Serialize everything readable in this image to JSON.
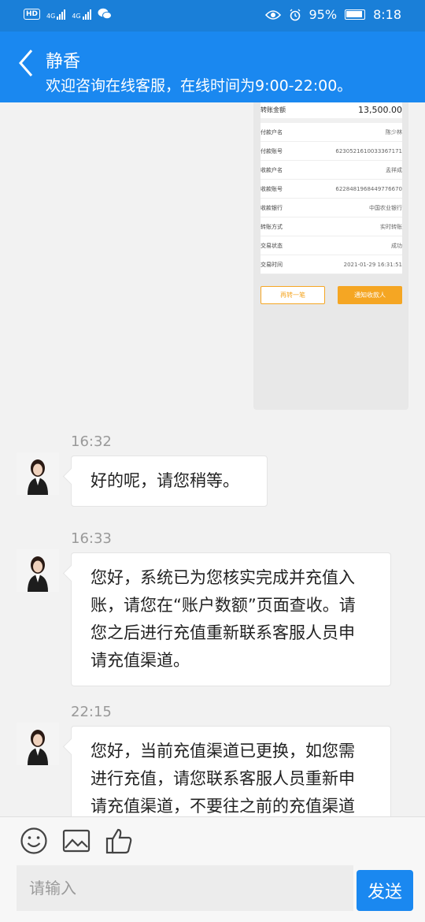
{
  "status_bar": {
    "network_left": "HD",
    "sim1": "4G",
    "sim2": "4G",
    "battery_percent": "95%",
    "time": "8:18"
  },
  "header": {
    "title": "静香",
    "subtitle": "欢迎咨询在线客服，在线时间为9:00-22:00。"
  },
  "receipt": {
    "amount_label": "转账金额",
    "amount_value": "13,500.00",
    "rows": [
      {
        "label": "付款户名",
        "value": "陈少林"
      },
      {
        "label": "付款账号",
        "value": "6230521610033367171"
      },
      {
        "label": "收款户名",
        "value": "孟祥成"
      },
      {
        "label": "收款账号",
        "value": "6228481968449776670"
      },
      {
        "label": "收款银行",
        "value": "中国农业银行"
      },
      {
        "label": "转账方式",
        "value": "实时转账"
      },
      {
        "label": "交易状态",
        "value": "成功"
      },
      {
        "label": "交易时间",
        "value": "2021-01-29 16:31:51"
      }
    ],
    "button_again": "再转一笔",
    "button_notify": "通知收款人"
  },
  "messages": [
    {
      "time": "16:32",
      "text": "好的呢，请您稍等。"
    },
    {
      "time": "16:33",
      "lines": [
        "您好，系统已为您核实完成并充值入",
        "账，请您在“账户数额”页面查收。请",
        "您之后进行充值重新联系客服人员申",
        "请充值渠道。"
      ]
    },
    {
      "time": "22:15",
      "lines": [
        "您好，当前充值渠道已更换，如您需",
        "进行充值，请您联系客服人员重新申",
        "请充值渠道，不要往之前的充值渠道"
      ]
    }
  ],
  "toolbar": {
    "icons": [
      "emoji-icon",
      "image-icon",
      "thumbs-up-icon"
    ]
  },
  "input": {
    "placeholder": "请输入",
    "send_label": "发送"
  },
  "colors": {
    "header_blue": "#1a88f0",
    "accent_orange": "#f5a623"
  }
}
